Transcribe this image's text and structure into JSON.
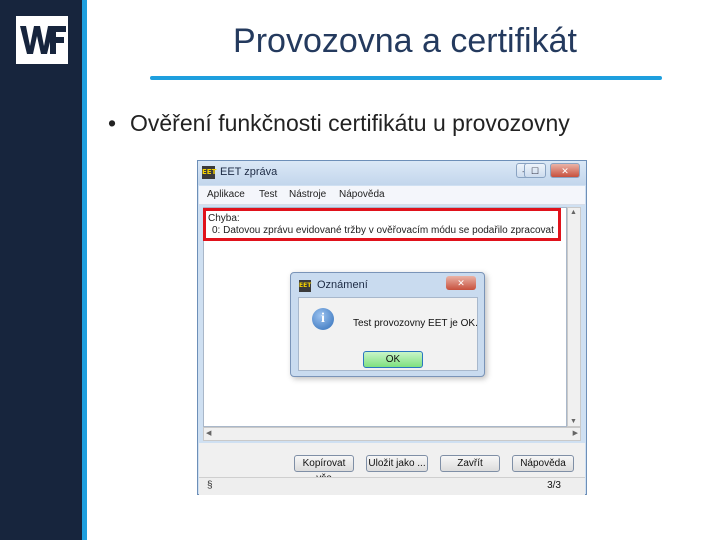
{
  "slide": {
    "title": "Provozovna a certifikát",
    "bullet": "Ověření funkčnosti certifikátu u provozovny",
    "bullet_symbol": "•",
    "colors": {
      "sidebar": "#17253d",
      "accent": "#1e9fde",
      "title": "#243a5e"
    }
  },
  "logo": {
    "icon": "wf-logo"
  },
  "window": {
    "title": "EET zpráva",
    "app_icon_text": "EET",
    "buttons": {
      "minimize": "—",
      "maximize": "☐",
      "close": "✕"
    },
    "menu": [
      "Aplikace",
      "Test",
      "Nástroje",
      "Nápověda"
    ],
    "content": {
      "line1": "Chyba:",
      "line2": "0: Datovou zprávu evidované tržby v ověřovacím módu se podařilo zpracovat"
    },
    "actions": {
      "copy_all": "Kopírovat vše",
      "save_as": "Uložit jako ...",
      "close": "Zavřít",
      "help": "Nápověda"
    },
    "status": {
      "icon": "§",
      "counter": "3/3"
    }
  },
  "dialog": {
    "title": "Oznámení",
    "close": "✕",
    "message": "Test provozovny EET je OK.",
    "ok": "OK",
    "icon_glyph": "i"
  }
}
